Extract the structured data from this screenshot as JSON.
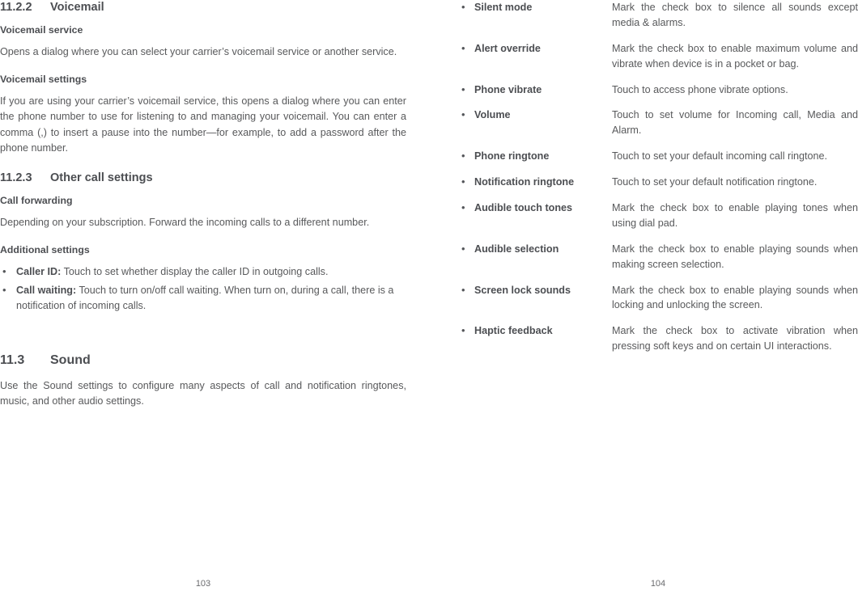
{
  "document": {
    "left_page": {
      "folio": "103",
      "sections": [
        {
          "number": "11.2.2",
          "title": "Voicemail"
        }
      ],
      "subheads": {
        "voicemail_service": "Voicemail service",
        "voicemail_settings": "Voicemail settings",
        "call_forwarding": "Call forwarding",
        "additional_settings": "Additional settings"
      },
      "paragraphs": {
        "voicemail_service_body": "Opens a dialog where you can select your carrier’s voicemail service or another service.",
        "voicemail_settings_body": "If you are using your carrier’s voicemail service, this opens a dialog where you can enter the phone number to use for listening to and managing your voicemail. You can enter a comma (,) to insert a pause into the number—for example, to add a password after the phone number.",
        "call_forwarding_body": "Depending on your subscription. Forward the incoming calls to a different number.",
        "sound_body": "Use the Sound settings to configure many aspects of call and notification ringtones, music, and other audio settings."
      },
      "heading_other_call": {
        "number": "11.2.3",
        "title": "Other call settings"
      },
      "heading_sound": {
        "number": "11.3",
        "title": "Sound"
      },
      "additional_settings_items": [
        {
          "term": "Caller ID:",
          "text": " Touch to set whether display the caller ID in outgoing calls."
        },
        {
          "term": "Call waiting:",
          "text": " Touch to turn on/off call waiting.  When turn on, during a call, there is a notification of incoming calls."
        }
      ]
    },
    "right_page": {
      "folio": "104",
      "sound_settings": [
        {
          "term": "Silent mode",
          "desc": "Mark the check box to silence all sounds except media & alarms.",
          "justify": true
        },
        {
          "term": "Alert override",
          "desc": "Mark the check box to enable maximum volume and vibrate when device is in a pocket or bag.",
          "justify": true
        },
        {
          "term": "Phone vibrate",
          "desc": "Touch to access phone vibrate options.",
          "justify": false
        },
        {
          "term": "Volume",
          "desc": "Touch to set volume for Incoming call, Media and Alarm.",
          "justify": true
        },
        {
          "term": "Phone ringtone",
          "desc": "Touch to set your default incoming call ringtone.",
          "justify": false
        },
        {
          "term": "Notification ringtone",
          "desc": "Touch to set your default notification ringtone.",
          "justify": false
        },
        {
          "term": "Audible touch tones",
          "desc": "Mark the check box to enable playing tones when using dial pad.",
          "justify": true
        },
        {
          "term": "Audible selection",
          "desc": "Mark the check box to enable playing sounds when making screen selection.",
          "justify": true
        },
        {
          "term": "Screen lock sounds",
          "desc": "Mark the check box to enable playing sounds when locking and unlocking the screen.",
          "justify": true
        },
        {
          "term": "Haptic feedback",
          "desc": "Mark the check box to activate vibration when pressing soft keys and on certain UI interactions.",
          "justify": true
        }
      ]
    }
  }
}
